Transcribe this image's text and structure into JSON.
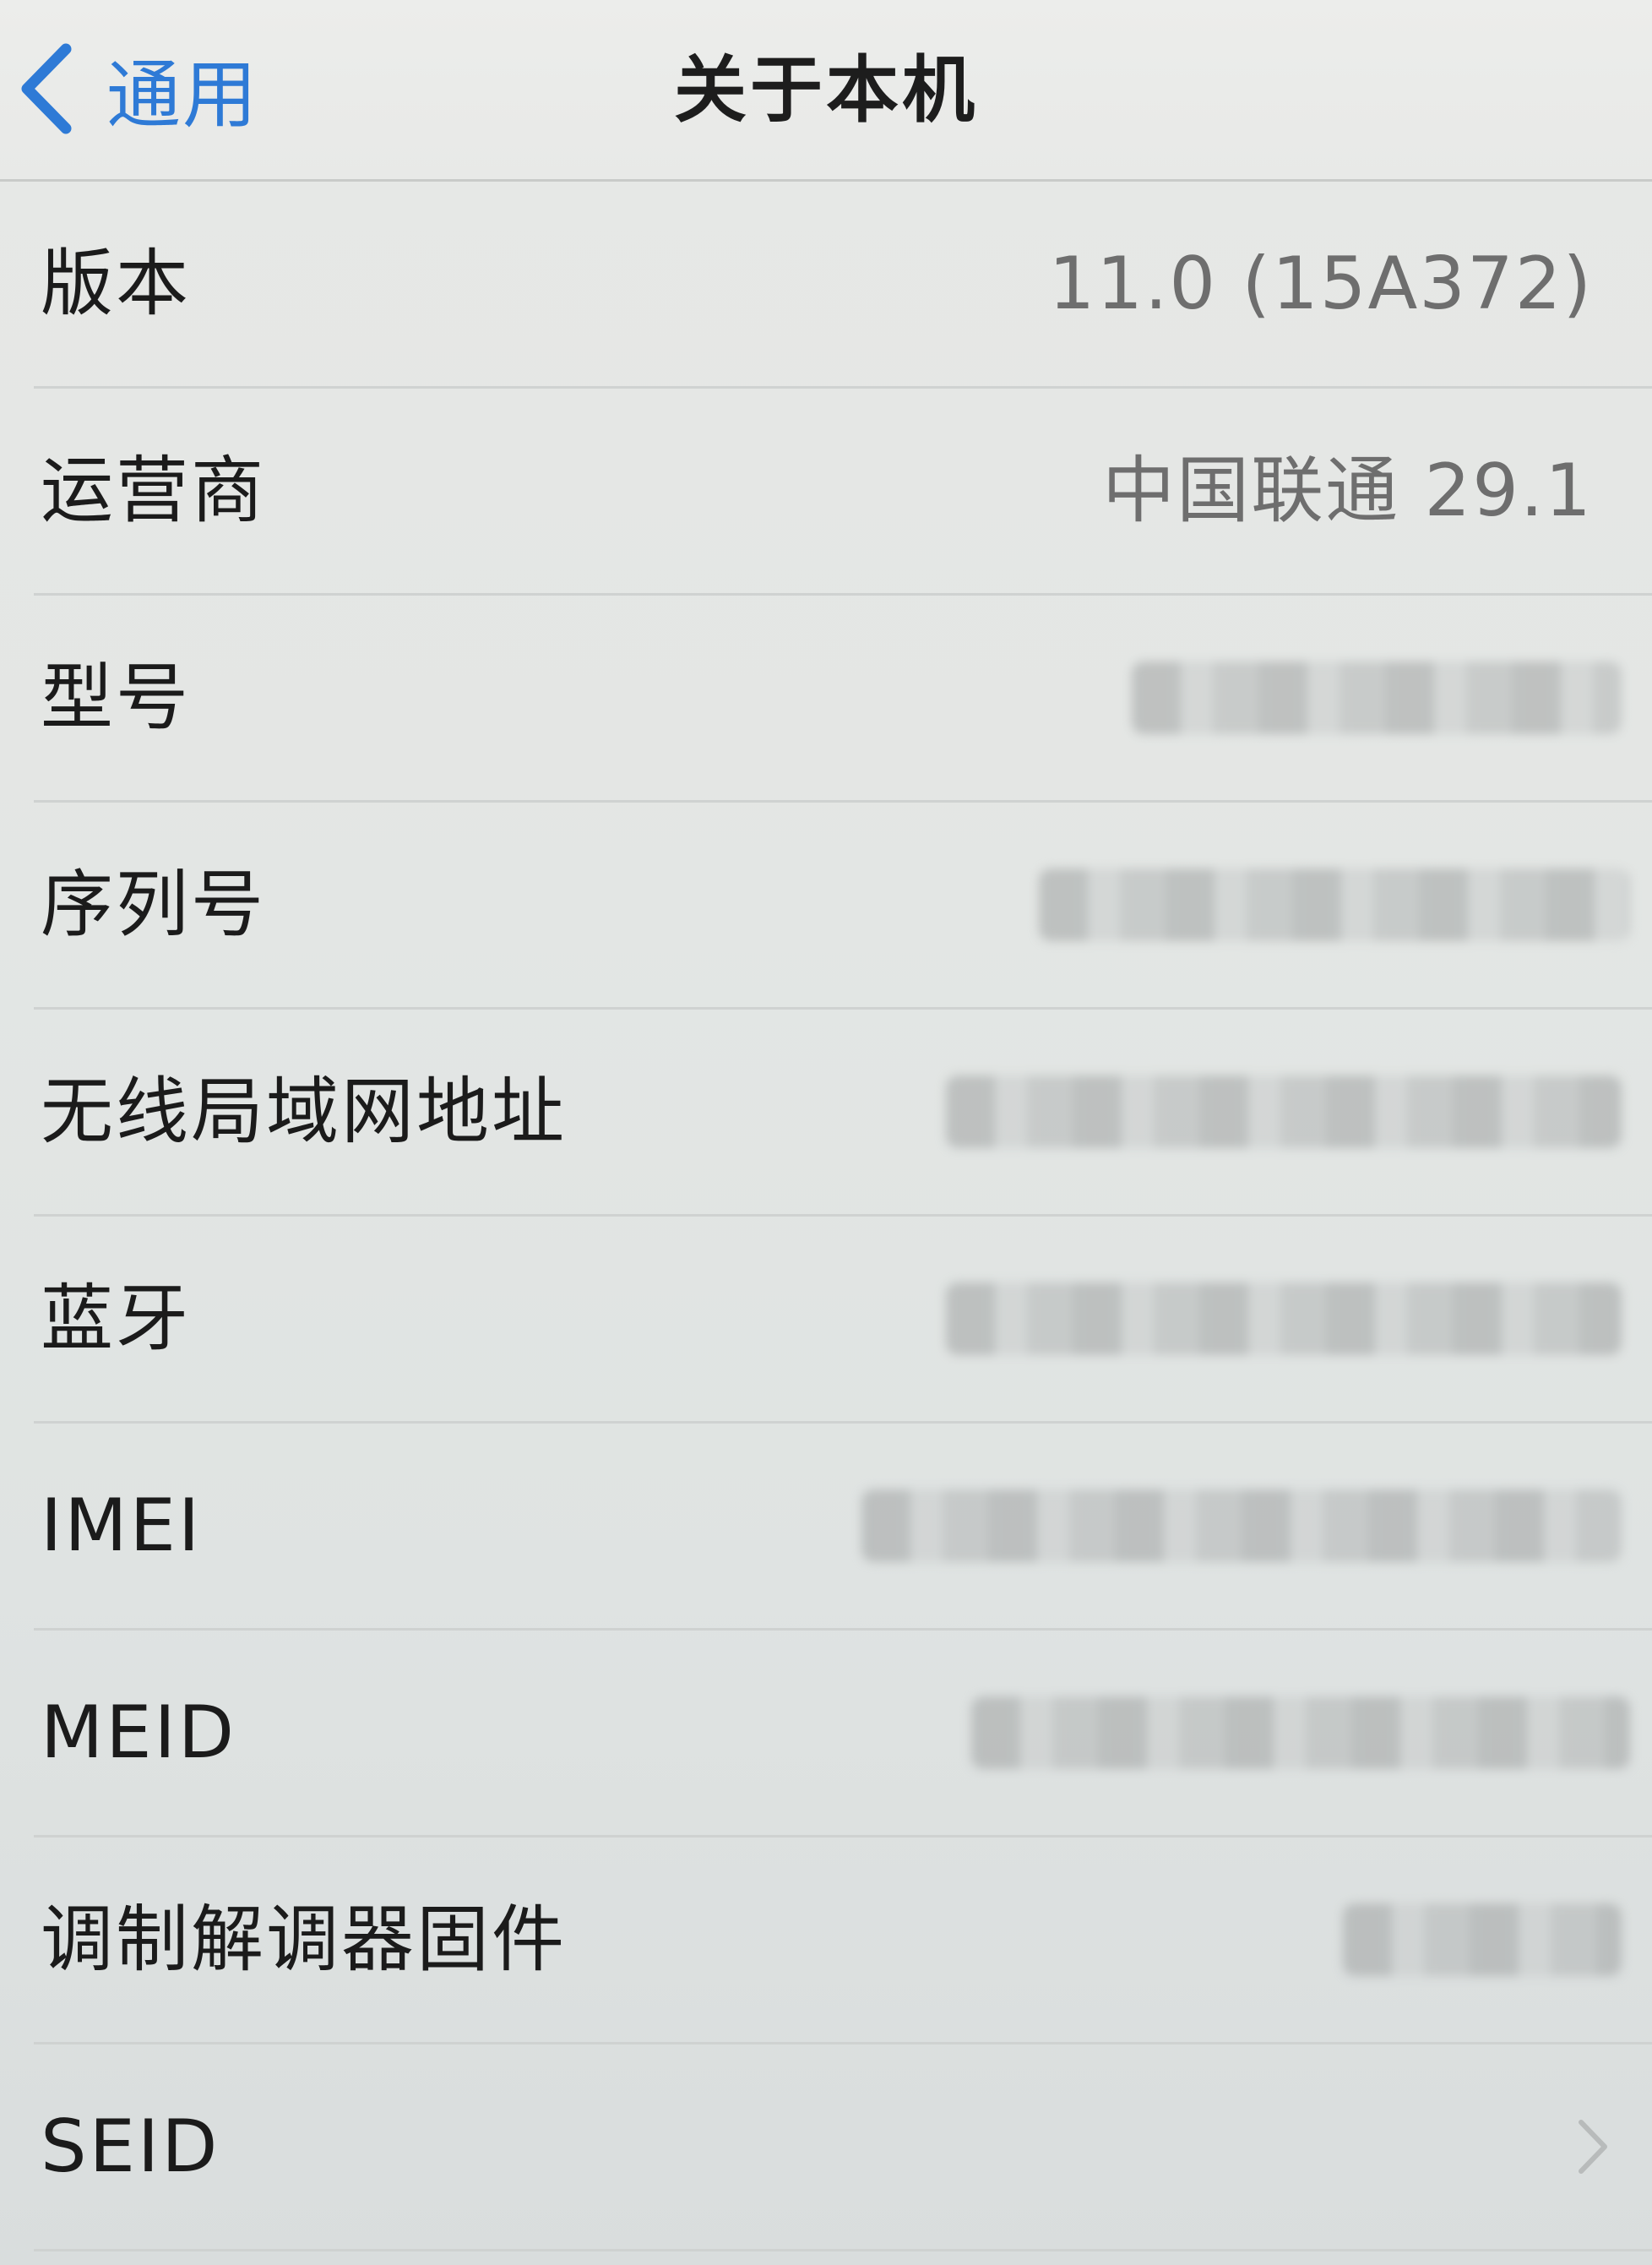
{
  "nav": {
    "back_label": "通用",
    "title": "关于本机"
  },
  "rows": [
    {
      "label": "版本",
      "value": "11.0 (15A372)"
    },
    {
      "label": "运营商",
      "value": "中国联通 29.1"
    },
    {
      "label": "型号",
      "value": ""
    },
    {
      "label": "序列号",
      "value": ""
    },
    {
      "label": "无线局域网地址",
      "value": ""
    },
    {
      "label": "蓝牙",
      "value": ""
    },
    {
      "label": "IMEI",
      "value": ""
    },
    {
      "label": "MEID",
      "value": ""
    },
    {
      "label": "调制解调器固件",
      "value": ""
    },
    {
      "label": "SEID",
      "value": ""
    }
  ],
  "colors": {
    "accent": "#2e7ad6",
    "background": "#e4e6e4",
    "value_text": "#6e6e6e",
    "separator": "#cfd2d1"
  },
  "icons": {
    "back": "chevron-left-icon",
    "disclosure": "chevron-right-icon"
  }
}
